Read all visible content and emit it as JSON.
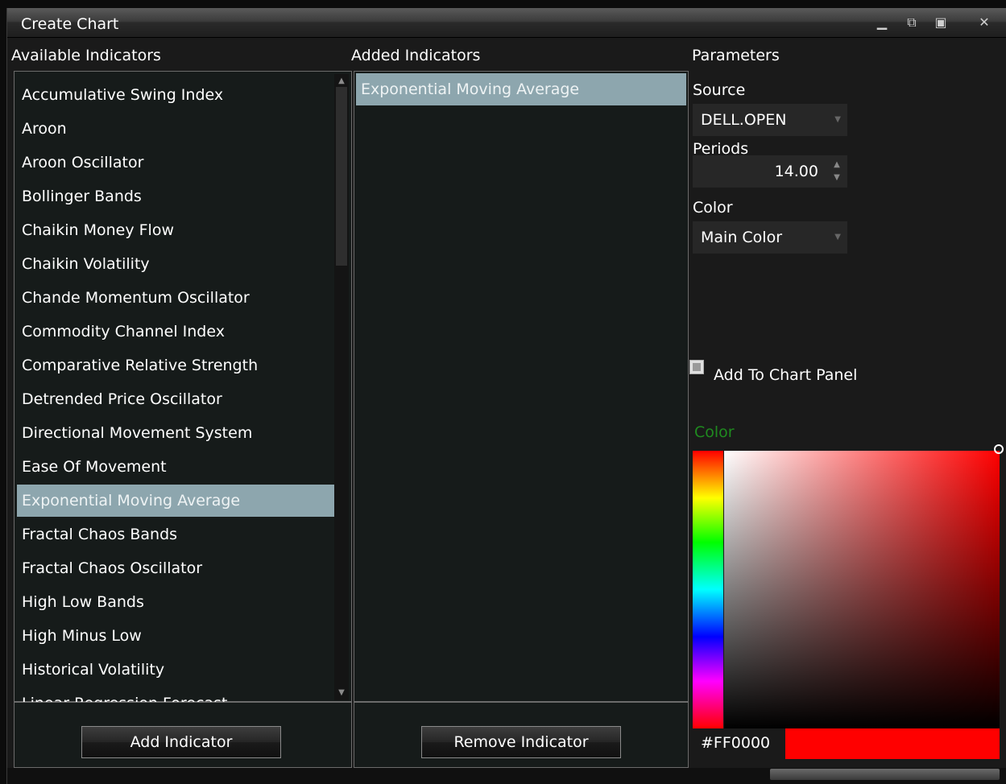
{
  "window": {
    "title": "Create Chart"
  },
  "columns": {
    "available": "Available Indicators",
    "added": "Added Indicators",
    "parameters": "Parameters"
  },
  "available_indicators": [
    "Accumulative Swing Index",
    "Aroon",
    "Aroon Oscillator",
    "Bollinger Bands",
    "Chaikin Money Flow",
    "Chaikin Volatility",
    "Chande Momentum Oscillator",
    "Commodity Channel Index",
    "Comparative Relative Strength",
    "Detrended Price Oscillator",
    "Directional Movement System",
    "Ease Of Movement",
    "Exponential Moving Average",
    "Fractal Chaos Bands",
    "Fractal Chaos Oscillator",
    "High Low Bands",
    "High Minus Low",
    "Historical Volatility",
    "Linear Regression Forecast"
  ],
  "selected_available": "Exponential Moving Average",
  "added_indicators": [
    "Exponential Moving Average"
  ],
  "buttons": {
    "add": "Add Indicator",
    "remove": "Remove Indicator"
  },
  "parameters": {
    "source_label": "Source",
    "source_value": "DELL.OPEN",
    "periods_label": "Periods",
    "periods_value": "14.00",
    "color_label": "Color",
    "color_value": "Main Color",
    "add_to_panel_label": "Add To Chart Panel",
    "add_to_panel_checked": false,
    "picker_label": "Color",
    "hex_value": "#FF0000",
    "selected_color": "#FF0000"
  },
  "window_controls": [
    "minimize",
    "restore",
    "maximize",
    "close"
  ],
  "colors": {
    "selection": "#8da6ae",
    "panel_bg": "#161b1a",
    "picker_label": "#1f8a1f"
  }
}
